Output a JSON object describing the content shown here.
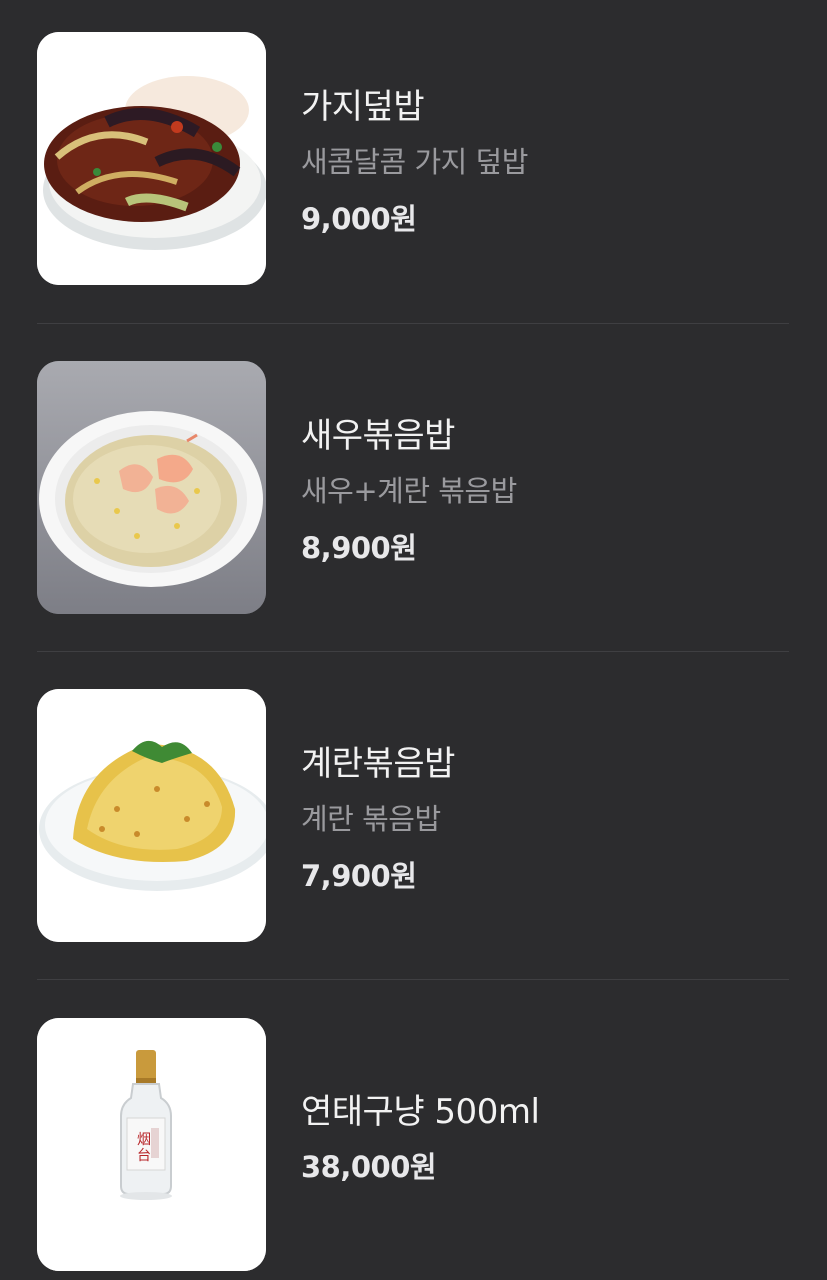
{
  "menu": {
    "items": [
      {
        "name": "가지덮밥",
        "description": "새콤달콤 가지 덮밥",
        "price": "9,000원",
        "image_icon": "eggplant-rice-bowl-icon"
      },
      {
        "name": "새우볶음밥",
        "description": "새우+계란 볶음밥",
        "price": "8,900원",
        "image_icon": "shrimp-fried-rice-icon"
      },
      {
        "name": "계란볶음밥",
        "description": "계란 볶음밥",
        "price": "7,900원",
        "image_icon": "egg-fried-rice-icon"
      },
      {
        "name": "연태구냥 500ml",
        "description": "",
        "price": "38,000원",
        "image_icon": "liquor-bottle-icon"
      }
    ]
  },
  "colors": {
    "background": "#2c2c2e",
    "name_text": "#f2f2f2",
    "description_text": "#9a9a9e",
    "price_text": "#e8e8ea",
    "divider": "#3f3f42"
  }
}
